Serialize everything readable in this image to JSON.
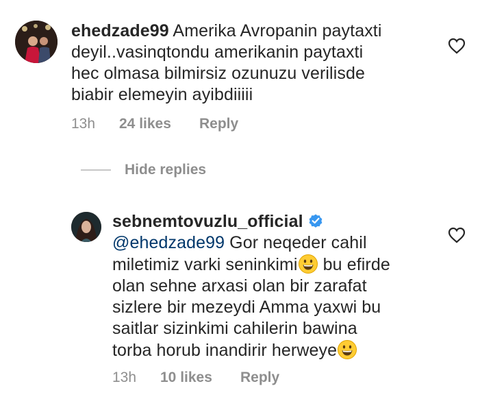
{
  "comments": [
    {
      "username": "ehedzade99",
      "text": "Amerika Avropanin paytaxti deyil..vasinqtondu amerikanin paytaxti hec olmasa bilmirsiz ozunuzu verilisde biabir elemeyin ayibdiiiii",
      "time": "13h",
      "likes": "24 likes",
      "reply": "Reply"
    },
    {
      "username": "sebnemtovuzlu_official",
      "verified": true,
      "mention": "@ehedzade99",
      "text_line1": "Gor neqeder cahil",
      "text_line2a": "miletimiz varki seninkimi",
      "text_line2b": "bu efirde",
      "text_line3": "olan sehne arxasi olan bir zarafat",
      "text_line4": "sizlere bir mezeydi Amma yaxwi bu",
      "text_line5": "saitlar sizinkimi cahilerin bawina",
      "text_line6": "torba horub inandirir herweye",
      "time": "13h",
      "likes": "10 likes",
      "reply": "Reply"
    }
  ],
  "hide_replies": "Hide replies",
  "icons": {
    "like": "heart-outline-icon",
    "verified": "verified-badge-icon",
    "emoji": "grinning-face-emoji"
  },
  "colors": {
    "verified": "#3897f0",
    "mention": "#00376b",
    "secondary_text": "#8e8e8e"
  }
}
